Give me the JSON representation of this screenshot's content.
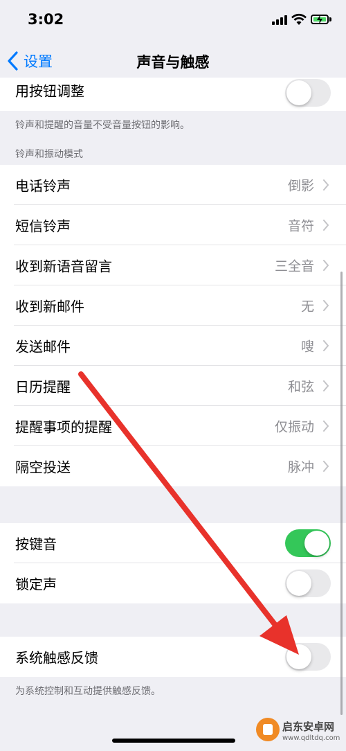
{
  "status_bar": {
    "time": "3:02"
  },
  "nav": {
    "back_label": "设置",
    "title": "声音与触感"
  },
  "group_buttons": {
    "label": "用按钮调整",
    "toggle_on": false,
    "footnote": "铃声和提醒的音量不受音量按钮的影响。"
  },
  "ringtones": {
    "header": "铃声和振动模式",
    "items": [
      {
        "label": "电话铃声",
        "value": "倒影"
      },
      {
        "label": "短信铃声",
        "value": "音符"
      },
      {
        "label": "收到新语音留言",
        "value": "三全音"
      },
      {
        "label": "收到新邮件",
        "value": "无"
      },
      {
        "label": "发送邮件",
        "value": "嗖"
      },
      {
        "label": "日历提醒",
        "value": "和弦"
      },
      {
        "label": "提醒事项的提醒",
        "value": "仅振动"
      },
      {
        "label": "隔空投送",
        "value": "脉冲"
      }
    ]
  },
  "sounds": {
    "items": [
      {
        "label": "按键音",
        "toggle_on": true
      },
      {
        "label": "锁定声",
        "toggle_on": false
      }
    ]
  },
  "haptics": {
    "label": "系统触感反馈",
    "toggle_on": false,
    "footnote": "为系统控制和互动提供触感反馈。"
  },
  "watermark": {
    "text": "启东安卓网",
    "url": "www.qdltdq.com"
  },
  "colors": {
    "accent": "#007aff",
    "toggle_on": "#34c759",
    "arrow": "#e8322b"
  }
}
